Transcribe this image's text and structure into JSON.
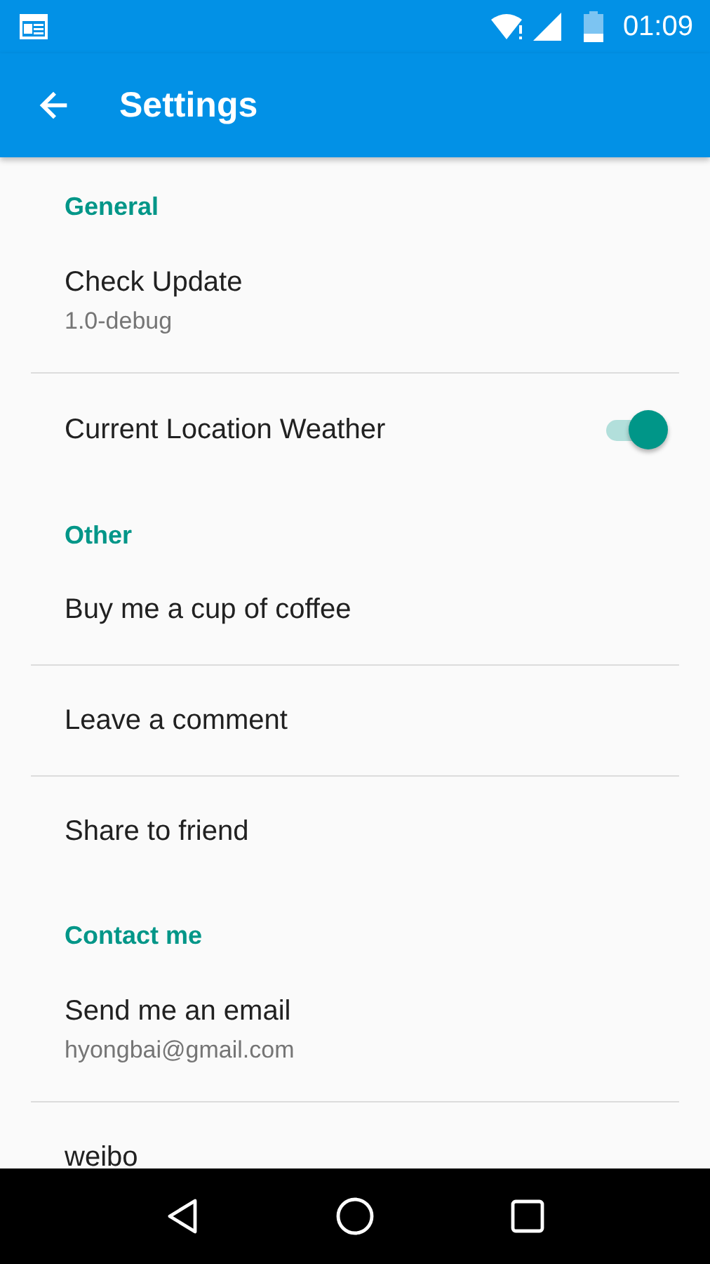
{
  "status_bar": {
    "time": "01:09"
  },
  "app_bar": {
    "title": "Settings"
  },
  "sections": [
    {
      "header": "General",
      "items": [
        {
          "kind": "text",
          "title": "Check Update",
          "summary": "1.0-debug",
          "divider": true
        },
        {
          "kind": "switch",
          "title": "Current Location Weather",
          "on": true,
          "divider": false
        }
      ]
    },
    {
      "header": "Other",
      "items": [
        {
          "kind": "text",
          "title": "Buy me a cup of coffee",
          "divider": true
        },
        {
          "kind": "text",
          "title": "Leave a comment",
          "divider": true
        },
        {
          "kind": "text",
          "title": "Share to friend",
          "divider": false
        }
      ]
    },
    {
      "header": "Contact me",
      "items": [
        {
          "kind": "text",
          "title": "Send me an email",
          "summary": "hyongbai@gmail.com",
          "divider": true
        },
        {
          "kind": "text",
          "title": "weibo",
          "divider": false
        }
      ]
    }
  ]
}
